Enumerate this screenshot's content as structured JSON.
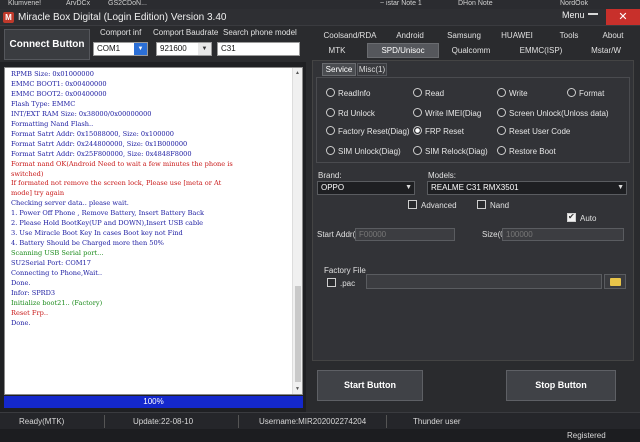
{
  "window": {
    "title": "Miracle Box Digital (Login Edition) Version 3.40",
    "menu_label": "Menu",
    "close_label": "✕",
    "logo_text": "M"
  },
  "taskbar": {
    "items": [
      "Klumvene!",
      "ArvDCx",
      "GS2CDoN...",
      "~ istar Note 1",
      "DHon Note",
      "NordOok"
    ]
  },
  "connection": {
    "connect_label": "Connect Button",
    "comport_label": "Comport inf",
    "comport_value": "COM1",
    "baud_label": "Comport Baudrate",
    "baud_value": "921600",
    "search_label": "Search phone model",
    "search_value": "C31"
  },
  "log": {
    "lines": [
      {
        "text": "RPMB Size: 0x01000000",
        "color": "#1a1aa0"
      },
      {
        "text": "EMMC BOOT1: 0x00400000",
        "color": "#1a1aa0"
      },
      {
        "text": "EMMC BOOT2: 0x00400000",
        "color": "#1a1aa0"
      },
      {
        "text": "Flash Type: EMMC",
        "color": "#1a1aa0"
      },
      {
        "text": "INT/EXT RAM  Size: 0x38000/0x00000000",
        "color": "#1a1aa0"
      },
      {
        "text": "Formatting Nand Flash..",
        "color": "#1a1aa0"
      },
      {
        "text": "Format Satrt Addr: 0x15088000, Size: 0x100000",
        "color": "#1a1aa0"
      },
      {
        "text": "Format Satrt Addr: 0x244800000, Size: 0x1B000000",
        "color": "#1a1aa0"
      },
      {
        "text": "Format Satrt Addr: 0x25F800000, Size: 0x4848F8000",
        "color": "#1a1aa0"
      },
      {
        "text": "Format nand OK(Android Need to wait a few minutes the phone is",
        "color": "#c81818"
      },
      {
        "text": "switched)",
        "color": "#c81818"
      },
      {
        "text": "If formated not remove the screen lock, Please use [meta or At",
        "color": "#c81818"
      },
      {
        "text": "mode] try again",
        "color": "#c81818"
      },
      {
        "text": "Checking server data.. please wait.",
        "color": "#1a1aa0"
      },
      {
        "text": "1. Power Off Phone , Remove Battery, Insert Battery Back",
        "color": "#1a1aa0"
      },
      {
        "text": "2. Please Hold BootKey(UP and DOWN),Insert USB cable",
        "color": "#1a1aa0"
      },
      {
        "text": "3. Use Miracle Boot Key In cases Boot key not Find",
        "color": "#1a1aa0"
      },
      {
        "text": "4. Battery Should be Charged more then 50%",
        "color": "#1a1aa0"
      },
      {
        "text": "Scanning USB Serial port...",
        "color": "#1a8a1a"
      },
      {
        "text": "SU2Serial Port: COM17",
        "color": "#1a1aa0"
      },
      {
        "text": "Connecting to Phone,Wait..",
        "color": "#1a1aa0"
      },
      {
        "text": "Done.",
        "color": "#1a1aa0"
      },
      {
        "text": "Infor: SPRD3",
        "color": "#1a1aa0"
      },
      {
        "text": "Initialize boot21.. (Factory)",
        "color": "#1a8a1a"
      },
      {
        "text": "Reset Frp..",
        "color": "#c81818"
      },
      {
        "text": "Done.",
        "color": "#1a1aa0"
      }
    ]
  },
  "progress": {
    "label": "100%",
    "value": 1.0
  },
  "tabs": {
    "row1": [
      "Coolsand/RDA",
      "Android",
      "Samsung",
      "HUAWEI",
      "Tools",
      "About"
    ],
    "row2": [
      "MTK",
      "SPD/Unisoc",
      "Qualcomm",
      "EMMC(ISP)",
      "Mstar/W"
    ],
    "active": "SPD/Unisoc"
  },
  "subtabs": {
    "items": [
      "Service",
      "Misc(1)"
    ],
    "active": "Service"
  },
  "options": {
    "items": [
      {
        "label": "ReadInfo",
        "selected": false
      },
      {
        "label": "Read",
        "selected": false
      },
      {
        "label": "Write",
        "selected": false
      },
      {
        "label": "Format",
        "selected": false
      },
      {
        "label": "Rd Unlock",
        "selected": false
      },
      {
        "label": "Write IMEI(Diag",
        "selected": false
      },
      {
        "label": "Screen Unlock(Unloss data)",
        "selected": false
      },
      {
        "label": "Factory Reset(Diag)",
        "selected": false
      },
      {
        "label": "FRP Reset",
        "selected": true
      },
      {
        "label": "Reset User Code",
        "selected": false
      },
      {
        "label": "SIM Unlock(Diag)",
        "selected": false
      },
      {
        "label": "SIM Relock(Diag)",
        "selected": false
      },
      {
        "label": "Restore Boot",
        "selected": false
      }
    ]
  },
  "device": {
    "brand_label": "Brand:",
    "brand_value": "OPPO",
    "models_label": "Models:",
    "model_value": "REALME C31 RMX3501",
    "advanced_label": "Advanced",
    "advanced_checked": false,
    "nand_label": "Nand",
    "nand_checked": false,
    "auto_label": "Auto",
    "auto_checked": true,
    "start_addr_label": "Start Addr(0",
    "start_addr_value": "F00000",
    "size_label": "Size(0",
    "size_value": "100000"
  },
  "factory": {
    "label": "Factory File",
    "file_label": ".pac",
    "file_checked": false,
    "folder_icon": "folder-icon"
  },
  "actions": {
    "start_label": "Start Button",
    "stop_label": "Stop Button"
  },
  "status": {
    "state": "Ready(MTK)",
    "update": "Update:22-08-10",
    "username": "Username:MIR202002274204",
    "user": "Thunder user"
  },
  "footer": {
    "registered": "Registered"
  }
}
